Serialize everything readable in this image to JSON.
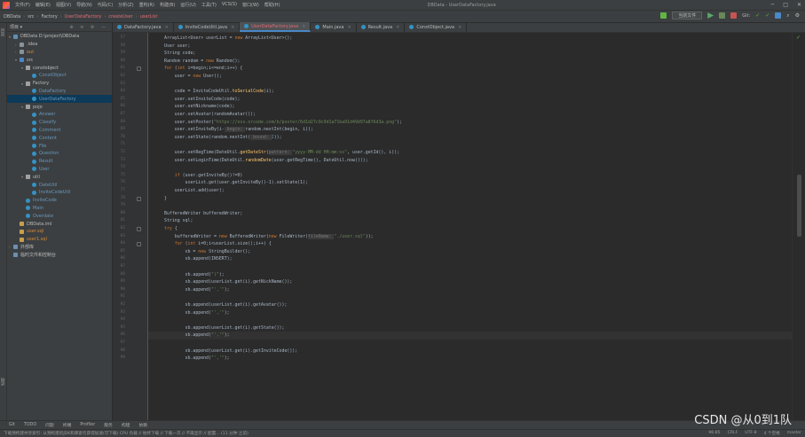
{
  "menubar": {
    "items": [
      "文件(F)",
      "编辑(E)",
      "视图(V)",
      "导航(N)",
      "代码(C)",
      "分析(Z)",
      "重构(R)",
      "构建(B)",
      "运行(U)",
      "工具(T)",
      "VCS(S)",
      "窗口(W)",
      "帮助(H)"
    ],
    "window_title": "DBData - UserDataFactory.java",
    "window_controls": [
      "─",
      "□",
      "✕"
    ]
  },
  "navbar": {
    "crumbs": [
      "DBData",
      "src",
      "Factory",
      "UserDataFactory",
      "createUser",
      "userList"
    ],
    "run_config": "当前文件",
    "git_label": "Git:"
  },
  "project": {
    "title": "项目 ▾",
    "tree": [
      {
        "depth": 0,
        "arrow": "▾",
        "icon": "module",
        "label": "DBData  D:\\project\\DBData",
        "color": ""
      },
      {
        "depth": 1,
        "arrow": "›",
        "icon": "folder",
        "label": ".idea",
        "color": ""
      },
      {
        "depth": 1,
        "arrow": "›",
        "icon": "folder",
        "label": "out",
        "color": "orange"
      },
      {
        "depth": 1,
        "arrow": "▾",
        "icon": "src",
        "label": "src",
        "color": ""
      },
      {
        "depth": 2,
        "arrow": "▾",
        "icon": "pkg",
        "label": "constobject",
        "color": ""
      },
      {
        "depth": 3,
        "arrow": "",
        "icon": "cls",
        "label": "ConstObject",
        "color": "blue"
      },
      {
        "depth": 2,
        "arrow": "▾",
        "icon": "pkg",
        "label": "Factory",
        "color": ""
      },
      {
        "depth": 3,
        "arrow": "",
        "icon": "cls",
        "label": "DataFactory",
        "color": "blue"
      },
      {
        "depth": 3,
        "arrow": "",
        "icon": "cls",
        "label": "UserDataFactory",
        "color": "blue"
      },
      {
        "depth": 2,
        "arrow": "▾",
        "icon": "pkg",
        "label": "pojo",
        "color": ""
      },
      {
        "depth": 3,
        "arrow": "",
        "icon": "cls",
        "label": "Answer",
        "color": "blue"
      },
      {
        "depth": 3,
        "arrow": "",
        "icon": "cls",
        "label": "Classify",
        "color": "blue"
      },
      {
        "depth": 3,
        "arrow": "",
        "icon": "cls",
        "label": "Comment",
        "color": "blue"
      },
      {
        "depth": 3,
        "arrow": "",
        "icon": "cls",
        "label": "Content",
        "color": "blue"
      },
      {
        "depth": 3,
        "arrow": "",
        "icon": "cls",
        "label": "File",
        "color": "blue"
      },
      {
        "depth": 3,
        "arrow": "",
        "icon": "cls",
        "label": "Question",
        "color": "blue"
      },
      {
        "depth": 3,
        "arrow": "",
        "icon": "cls",
        "label": "Result",
        "color": "blue"
      },
      {
        "depth": 3,
        "arrow": "",
        "icon": "cls",
        "label": "User",
        "color": "blue"
      },
      {
        "depth": 2,
        "arrow": "▾",
        "icon": "pkg",
        "label": "util",
        "color": ""
      },
      {
        "depth": 3,
        "arrow": "",
        "icon": "cls",
        "label": "DateUtil",
        "color": "blue"
      },
      {
        "depth": 3,
        "arrow": "",
        "icon": "cls",
        "label": "InviteCodeUtil",
        "color": "blue"
      },
      {
        "depth": 2,
        "arrow": "",
        "icon": "cls",
        "label": "InviteCode",
        "color": "blue"
      },
      {
        "depth": 2,
        "arrow": "",
        "icon": "cls",
        "label": "Main",
        "color": "blue"
      },
      {
        "depth": 2,
        "arrow": "",
        "icon": "cls",
        "label": "Overdate",
        "color": "blue"
      },
      {
        "depth": 1,
        "arrow": "",
        "icon": "file",
        "label": "DBData.iml",
        "color": ""
      },
      {
        "depth": 1,
        "arrow": "",
        "icon": "file",
        "label": "user.sql",
        "color": "orange"
      },
      {
        "depth": 1,
        "arrow": "",
        "icon": "file",
        "label": "user1.sql",
        "color": "orange"
      },
      {
        "depth": 0,
        "arrow": "›",
        "icon": "lib",
        "label": "外部库",
        "color": ""
      },
      {
        "depth": 0,
        "arrow": "",
        "icon": "lib",
        "label": "临时文件和控制台",
        "color": ""
      }
    ]
  },
  "tabs": [
    {
      "label": "DataFactory.java",
      "active": false
    },
    {
      "label": "InviteCodeUtil.java",
      "active": false
    },
    {
      "label": "UserDataFactory.java",
      "active": true
    },
    {
      "label": "Main.java",
      "active": false
    },
    {
      "label": "Result.java",
      "active": false
    },
    {
      "label": "ConstObject.java",
      "active": false
    }
  ],
  "code": {
    "first_line": 57,
    "current_line": 96,
    "lines": [
      [
        [
          "",
          "ArrayList<User> userList = "
        ],
        [
          "kw",
          "new "
        ],
        [
          "",
          "ArrayList<User>();"
        ]
      ],
      [
        [
          "",
          "User user;"
        ]
      ],
      [
        [
          "",
          "String code;"
        ]
      ],
      [
        [
          "",
          "Random random = "
        ],
        [
          "kw",
          "new "
        ],
        [
          "",
          "Random();"
        ]
      ],
      [
        [
          "kw",
          "for "
        ],
        [
          "",
          "("
        ],
        [
          "kw",
          "int "
        ],
        [
          "",
          "i=begin;i<=end;i++) {"
        ]
      ],
      [
        [
          "",
          "    user = "
        ],
        [
          "kw",
          "new "
        ],
        [
          "",
          "User();"
        ]
      ],
      [
        [
          "",
          ""
        ]
      ],
      [
        [
          "",
          "    code = InviteCodeUtil."
        ],
        [
          "mth",
          "toSerialCode"
        ],
        [
          "",
          "(i);"
        ]
      ],
      [
        [
          "",
          "    user.setInviteCode(code);"
        ]
      ],
      [
        [
          "",
          "    user.setNickname(code);"
        ]
      ],
      [
        [
          "",
          "    user.setAvatar(randomAvatar());"
        ]
      ],
      [
        [
          "",
          "    user.setPoster("
        ],
        [
          "str",
          "\"https://oss.orcode.com/b/poster/6d1d27c9c9d1a71ba91d49d97a8f6d3a.png\""
        ],
        [
          "",
          ");"
        ]
      ],
      [
        [
          "",
          "    user.setInviteBy(i-"
        ],
        [
          "hint",
          " begin: "
        ],
        [
          "",
          "random.nextInt(begin, i));"
        ]
      ],
      [
        [
          "",
          "    user.setState(random.nextInt("
        ],
        [
          "hint",
          " bound: "
        ],
        [
          "num",
          "2"
        ],
        [
          "",
          "));"
        ]
      ],
      [
        [
          "",
          ""
        ]
      ],
      [
        [
          "",
          "    user.setRegTime(DateUtil."
        ],
        [
          "mth",
          "getDateStr"
        ],
        [
          "",
          "("
        ],
        [
          "hint",
          "pattern: "
        ],
        [
          "str",
          "\"yyyy-MM-dd HH:mm:ss\""
        ],
        [
          "",
          ", user.getId(), i));"
        ]
      ],
      [
        [
          "",
          "    user.setLoginTime(DateUtil."
        ],
        [
          "mth",
          "randomDate"
        ],
        [
          "",
          "(user.getRegTime(), DateUtil.now()));"
        ]
      ],
      [
        [
          "",
          ""
        ]
      ],
      [
        [
          "",
          "    "
        ],
        [
          "kw",
          "if "
        ],
        [
          "",
          "(user.getInviteBy()!=0)"
        ]
      ],
      [
        [
          "",
          "        userList.get(user.getInviteBy()-1).setState(1);"
        ]
      ],
      [
        [
          "",
          "    userList.add(user);"
        ]
      ],
      [
        [
          "",
          "}"
        ]
      ],
      [
        [
          "",
          ""
        ]
      ],
      [
        [
          "",
          "BufferedWriter bufferedWriter;"
        ]
      ],
      [
        [
          "",
          "String sql;"
        ]
      ],
      [
        [
          "kw",
          "try "
        ],
        [
          "",
          "{"
        ]
      ],
      [
        [
          "",
          "    bufferedWriter = "
        ],
        [
          "kw",
          "new "
        ],
        [
          "",
          "BufferedWriter("
        ],
        [
          "kw",
          "new "
        ],
        [
          "",
          "FileWriter("
        ],
        [
          "hint",
          "fileName: "
        ],
        [
          "str",
          "\"./user.sql\""
        ],
        [
          "",
          "));"
        ]
      ],
      [
        [
          "",
          "    "
        ],
        [
          "kw",
          "for "
        ],
        [
          "",
          "("
        ],
        [
          "kw",
          "int "
        ],
        [
          "",
          "i=0;i<userList.size();i++) {"
        ]
      ],
      [
        [
          "",
          "        sb = "
        ],
        [
          "kw",
          "new "
        ],
        [
          "",
          "StringBuilder();"
        ]
      ],
      [
        [
          "",
          "        sb.append(INSERT);"
        ]
      ],
      [
        [
          "",
          ""
        ]
      ],
      [
        [
          "",
          "        sb.append("
        ],
        [
          "str",
          "\"(\""
        ],
        [
          "",
          ");"
        ]
      ],
      [
        [
          "",
          "        sb.append(userList.get(i).getNickName());"
        ]
      ],
      [
        [
          "",
          "        sb.append("
        ],
        [
          "str",
          "\"','\""
        ],
        [
          "",
          ");"
        ]
      ],
      [
        [
          "",
          ""
        ]
      ],
      [
        [
          "",
          "        sb.append(userList.get(i).getAvatar());"
        ]
      ],
      [
        [
          "",
          "        sb.append("
        ],
        [
          "str",
          "\"','\""
        ],
        [
          "",
          ");"
        ]
      ],
      [
        [
          "",
          ""
        ]
      ],
      [
        [
          "",
          "        sb.append(userList.get(i).getState());"
        ]
      ],
      [
        [
          "",
          "        sb.append("
        ],
        [
          "str",
          "\"','\""
        ],
        [
          "",
          ");"
        ]
      ],
      [
        [
          "",
          ""
        ]
      ],
      [
        [
          "",
          "        sb.append(userList.get(i).getInviteCode());"
        ]
      ],
      [
        [
          "",
          "        sb.append("
        ],
        [
          "str",
          "\"','\""
        ],
        [
          "",
          ");"
        ]
      ]
    ]
  },
  "bottom_tools": [
    "Git",
    "TODO",
    "问题",
    "终端",
    "Profiler",
    "服务",
    "构建",
    "依赖"
  ],
  "status": {
    "message": "下载预构建共享索引: 从预构建的JDK和库索引获得加速(可下载) CPU 负载 // 始终下载 // 下载一次 // 不再显示 // 配置... (11 分钟 之前)",
    "position": "96:85",
    "crlf": "CRLF",
    "encoding": "UTF-8",
    "indent": "4 个空格",
    "vcs": "master"
  },
  "watermark": "CSDN @从0到1队",
  "colors": {
    "accent": "#4a88c7",
    "selection": "#0d3a58",
    "error_tab": "#e06c75"
  }
}
